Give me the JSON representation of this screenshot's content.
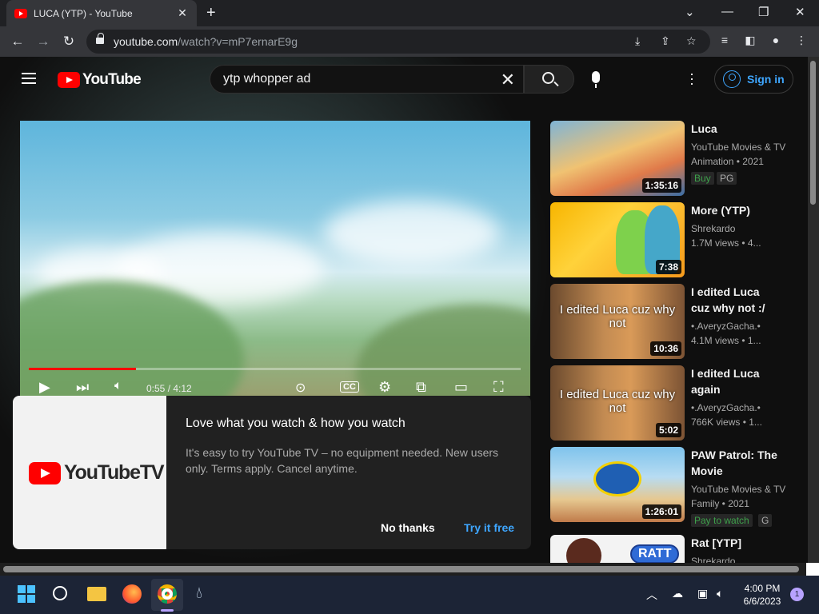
{
  "browser": {
    "tab_title": "LUCA (YTP) - YouTube",
    "new_tab": "+",
    "url_host": "youtube.com",
    "url_path": "/watch?v=mP7ernarE9g"
  },
  "header": {
    "logo_text": "YouTube",
    "search_value": "ytp whopper ad",
    "sign_in": "Sign in"
  },
  "player": {
    "time": "0:55 / 4:12",
    "progress": 0.218
  },
  "promo": {
    "logo_text": "YouTubeTV",
    "title": "Love what you watch & how you watch",
    "body": "It's easy to try YouTube TV – no equipment needed. New users only. Terms apply. Cancel anytime.",
    "dismiss": "No thanks",
    "cta": "Try it free"
  },
  "recommendations": [
    {
      "title": "Luca",
      "line1": "YouTube Movies & TV",
      "line2": "Animation • 2021",
      "badges": [
        "Buy",
        "PG"
      ],
      "duration": "1:35:16",
      "caption": ""
    },
    {
      "title": "More (YTP)",
      "line1": "Shrekardo",
      "line2": "1.7M views  • 4...",
      "badges": [],
      "duration": "7:38",
      "caption": ""
    },
    {
      "title": "I edited Luca cuz why not :/",
      "line1": "•.AveryzGacha.•",
      "line2": "4.1M views  • 1...",
      "badges": [],
      "duration": "10:36",
      "caption": "I edited Luca cuz why not"
    },
    {
      "title": "I edited Luca again",
      "line1": "•.AveryzGacha.•",
      "line2": "766K views  • 1...",
      "badges": [],
      "duration": "5:02",
      "caption": "I edited Luca cuz why not"
    },
    {
      "title": "PAW Patrol: The Movie",
      "line1": "YouTube Movies & TV",
      "line2": "Family • 2021",
      "badges": [
        "Pay to watch",
        "G"
      ],
      "duration": "1:26:01",
      "caption": ""
    },
    {
      "title": "Rat [YTP]",
      "line1": "Shrekardo",
      "line2": "",
      "badges": [],
      "duration": "",
      "caption": "RATT"
    }
  ],
  "taskbar": {
    "time": "4:00 PM",
    "date": "6/6/2023",
    "notifications": "1"
  },
  "colors": {
    "accent_red": "#ff0000",
    "link_blue": "#3ea6ff",
    "buy_green": "#3ea14b"
  }
}
